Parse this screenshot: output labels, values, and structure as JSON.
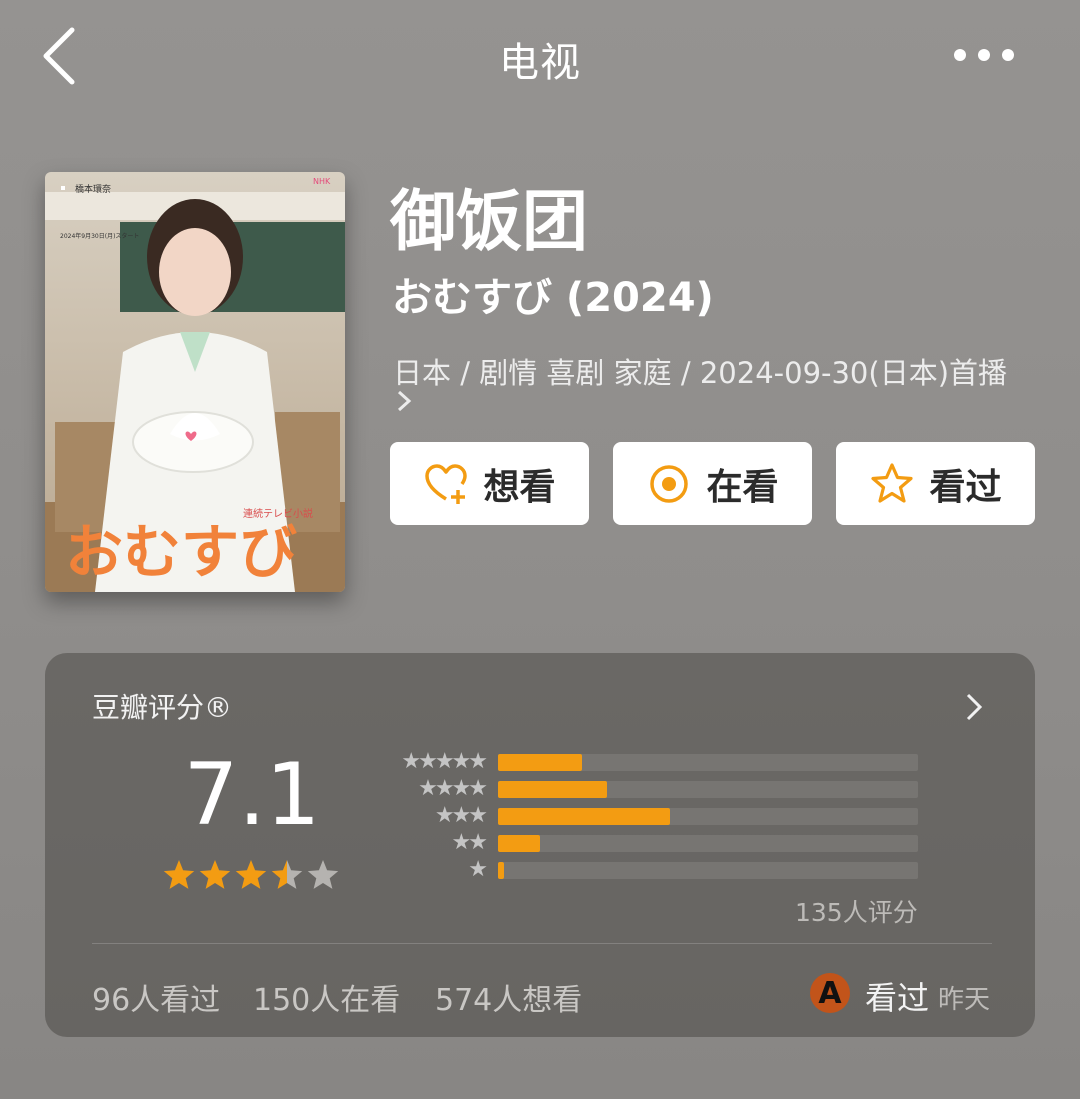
{
  "nav": {
    "title": "电视"
  },
  "poster": {
    "logo_text": "おむすび",
    "caption": "連続テレビ小説",
    "cast": "橋本環奈",
    "date_note": "2024年9月30日(月)スタート",
    "brand": "NHK"
  },
  "movie": {
    "title": "御饭团",
    "original_title": "おむすび (2024)",
    "meta": "日本 / 剧情 喜剧 家庭 / 2024-09-30(日本)首播"
  },
  "actions": [
    {
      "label": "想看",
      "icon": "heart-plus-icon"
    },
    {
      "label": "在看",
      "icon": "target-icon"
    },
    {
      "label": "看过",
      "icon": "star-outline-icon"
    }
  ],
  "rating": {
    "label": "豆瓣评分®",
    "score": "7.1",
    "stars": 3.5,
    "distribution": [
      {
        "stars": "★★★★★",
        "fraction": 0.2
      },
      {
        "stars": "★★★★",
        "fraction": 0.26
      },
      {
        "stars": "★★★",
        "fraction": 0.41
      },
      {
        "stars": "★★",
        "fraction": 0.1
      },
      {
        "stars": "★",
        "fraction": 0.015
      }
    ],
    "count_text": "135人评分"
  },
  "stats": {
    "watched": "96人看过",
    "watching": "150人在看",
    "wish": "574人想看"
  },
  "user": {
    "avatar_letter": "A",
    "action": "看过",
    "time": "昨天"
  },
  "colors": {
    "accent": "#f39c12",
    "star": "#f39c12"
  }
}
